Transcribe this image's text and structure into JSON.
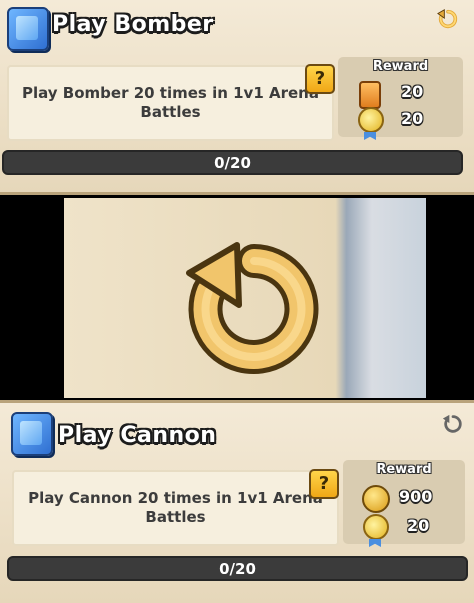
{
  "cards": [
    {
      "title": "Play Bomber",
      "description": "Play Bomber 20 times in 1v1 Arena Battles",
      "help_label": "?",
      "reward_label": "Reward",
      "rewards": [
        {
          "icon": "card-icon",
          "value": "20"
        },
        {
          "icon": "medal-icon",
          "value": "20"
        }
      ],
      "progress_text": "0/20",
      "progress": 0
    },
    {
      "title": "Play Cannon",
      "description": "Play Cannon 20 times in 1v1 Arena Battles",
      "help_label": "?",
      "reward_label": "Reward",
      "rewards": [
        {
          "icon": "gold-coin-icon",
          "value": "900"
        },
        {
          "icon": "medal-icon",
          "value": "20"
        }
      ],
      "progress_text": "0/20",
      "progress": 0
    }
  ],
  "zoom_icon": "refresh-arrow-icon",
  "colors": {
    "card_bg": "#f4ead7",
    "bar_bg": "#3b3b3b",
    "accent_gold": "#f0a716",
    "book_blue": "#2f6fd1"
  }
}
